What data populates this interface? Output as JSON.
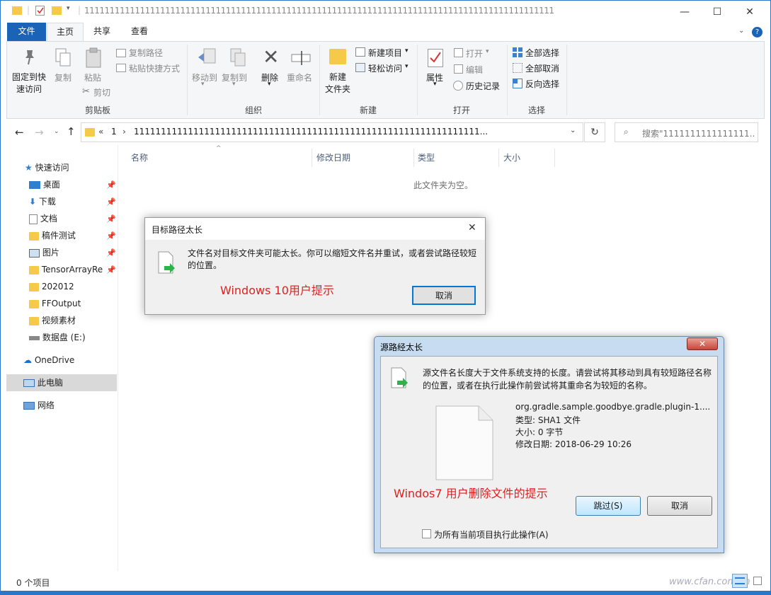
{
  "window": {
    "title": "11111111111111111111111111111111111111111111111111111111111111111111111111111111111111111111111111111111111111111111111111111111111111111111111111111111111111111111111111111111111111111111111111111111111",
    "minimize": "—",
    "maximize": "☐",
    "close": "✕"
  },
  "tabs": {
    "file": "文件",
    "home": "主页",
    "share": "共享",
    "view": "查看"
  },
  "ribbon": {
    "clipboard": {
      "label": "剪贴板",
      "pin": "固定到快\n速访问",
      "pin_line1": "固定到快",
      "pin_line2": "速访问",
      "copy": "复制",
      "paste": "粘贴",
      "copy_path": "复制路径",
      "paste_shortcut": "粘贴快捷方式",
      "cut": "剪切"
    },
    "organize": {
      "label": "组织",
      "move_to": "移动到",
      "copy_to": "复制到",
      "delete": "删除",
      "rename": "重命名"
    },
    "new": {
      "label": "新建",
      "new_folder_line1": "新建",
      "new_folder_line2": "文件夹",
      "new_item": "新建项目",
      "easy_access": "轻松访问"
    },
    "open": {
      "label": "打开",
      "properties": "属性",
      "open": "打开",
      "edit": "编辑",
      "history": "历史记录"
    },
    "select": {
      "label": "选择",
      "select_all": "全部选择",
      "select_none": "全部取消",
      "invert": "反向选择"
    }
  },
  "address": {
    "path_prefix": "«",
    "crumb1": "1",
    "crumb_sep": "›",
    "crumb2": "1111111111111111111111111111111111111111111111111111111111111111...",
    "search_placeholder": "搜索\"1111111111111111..."
  },
  "nav": {
    "quick_access": "快速访问",
    "items": [
      {
        "label": "桌面",
        "pinned": true
      },
      {
        "label": "下载",
        "pinned": true
      },
      {
        "label": "文档",
        "pinned": true
      },
      {
        "label": "稿件测试",
        "pinned": true
      },
      {
        "label": "图片",
        "pinned": true
      },
      {
        "label": "TensorArrayRe",
        "pinned": true
      },
      {
        "label": "202012",
        "pinned": false
      },
      {
        "label": "FFOutput",
        "pinned": false
      },
      {
        "label": "视频素材",
        "pinned": false
      },
      {
        "label": "数据盘 (E:)",
        "pinned": false
      }
    ],
    "onedrive": "OneDrive",
    "this_pc": "此电脑",
    "network": "网络"
  },
  "content": {
    "columns": [
      "名称",
      "修改日期",
      "类型",
      "大小"
    ],
    "empty_message": "此文件夹为空。"
  },
  "dialog_win10": {
    "title": "目标路径太长",
    "message_line1": "文件名对目标文件夹可能太长。你可以缩短文件名并重试，或者尝试路径较短",
    "message_line2": "的位置。",
    "annotation": "Windows 10用户提示",
    "cancel": "取消"
  },
  "dialog_win7": {
    "title": "源路经太长",
    "message_line1": "源文件名长度大于文件系统支持的长度。请尝试将其移动到具有较短路径名称",
    "message_line2": "的位置，或者在执行此操作前尝试将其重命名为较短的名称。",
    "file_name": "org.gradle.sample.goodbye.gradle.plugin-1....",
    "file_type": "类型: SHA1 文件",
    "file_size": "大小: 0 字节",
    "file_modified": "修改日期: 2018-06-29 10:26",
    "annotation": "Windos7 用户删除文件的提示",
    "skip": "跳过(S)",
    "cancel": "取消",
    "apply_all": "为所有当前项目执行此操作(A)"
  },
  "status": {
    "item_count": "0 个项目",
    "watermark": "www.cfan.com.cn"
  },
  "colors": {
    "accent": "#1a63b6",
    "annotation_red": "#e02020",
    "folder": "#f5c94a"
  }
}
